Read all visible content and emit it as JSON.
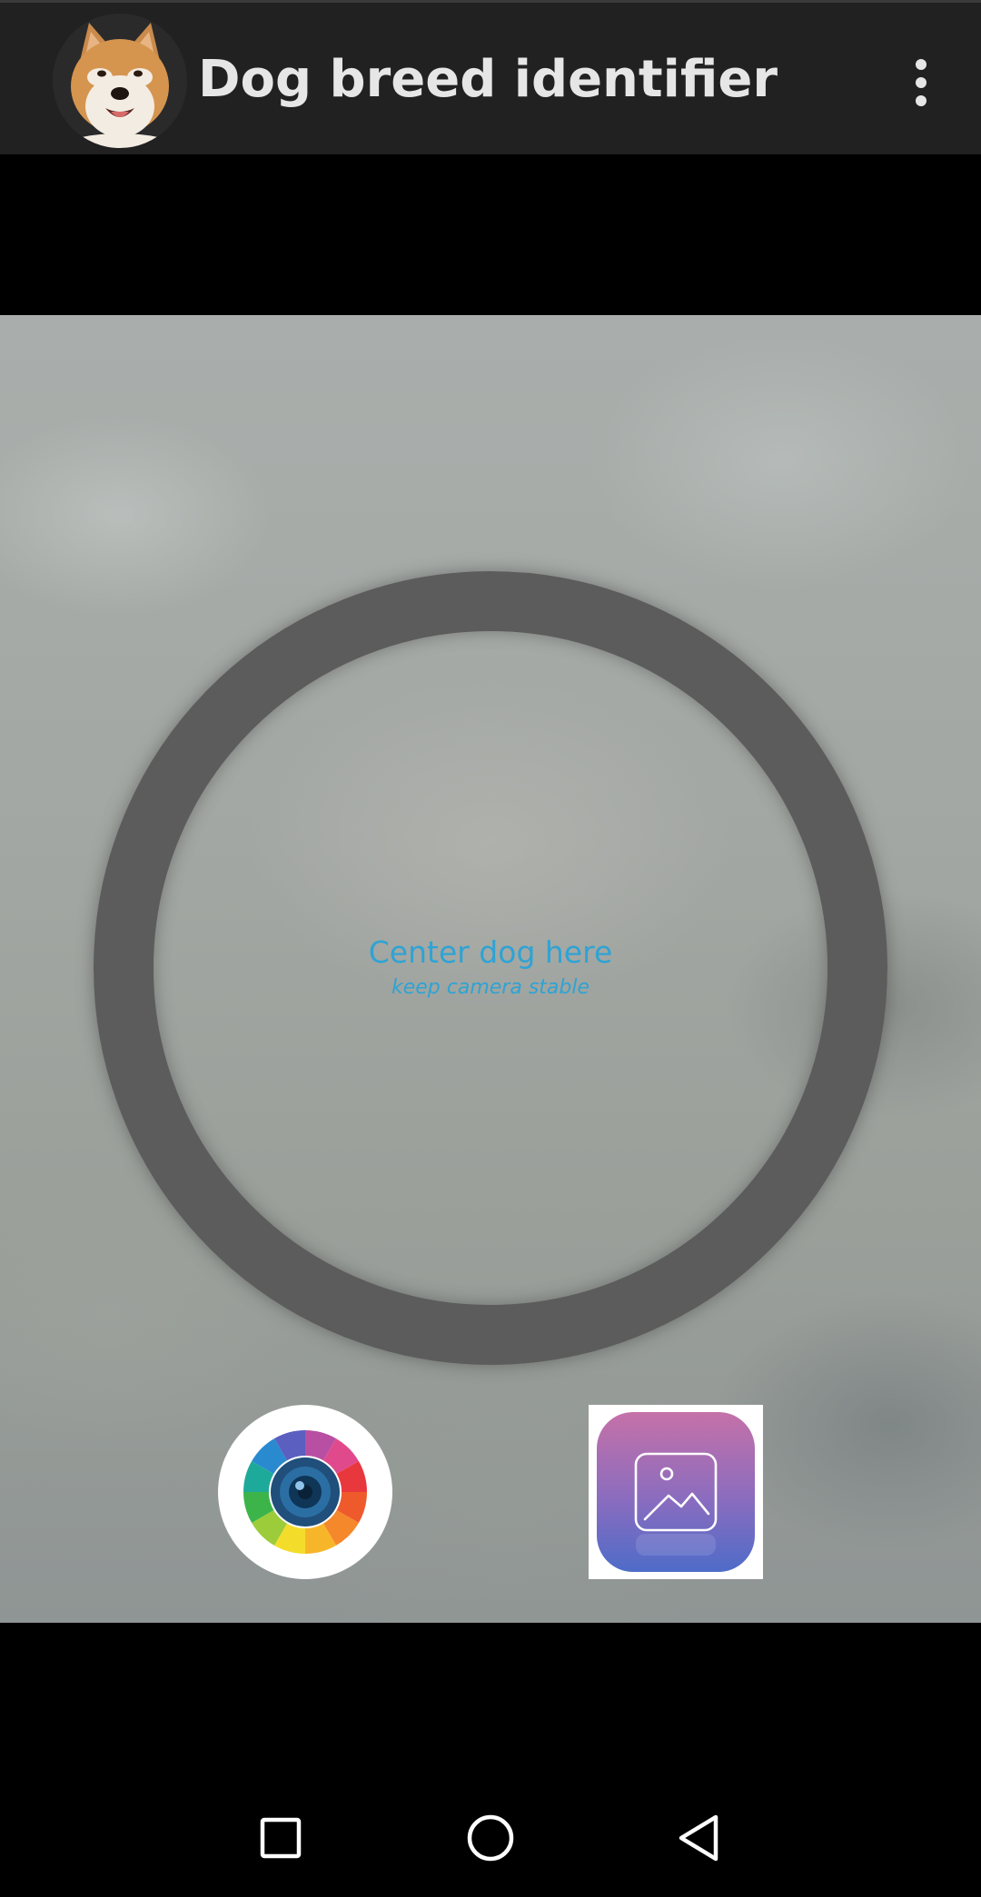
{
  "app_bar": {
    "title": "Dog breed identifier",
    "avatar_icon": "akita-dog-avatar",
    "overflow_icon": "more-vert-icon"
  },
  "camera_view": {
    "hint_title": "Center dog here",
    "hint_subtitle": "keep camera stable"
  },
  "actions": {
    "camera_icon": "color-wheel-camera-icon",
    "gallery_icon": "gallery-image-icon"
  },
  "nav_bar": {
    "recents_icon": "square-recents-icon",
    "home_icon": "circle-home-icon",
    "back_icon": "triangle-back-icon"
  },
  "colors": {
    "app_bar_bg": "#212121",
    "hint_text": "#2fa3d4",
    "ring": "#5c5c5c",
    "gallery_gradient_top": "#c571a8",
    "gallery_gradient_bottom": "#4e6cc8"
  }
}
